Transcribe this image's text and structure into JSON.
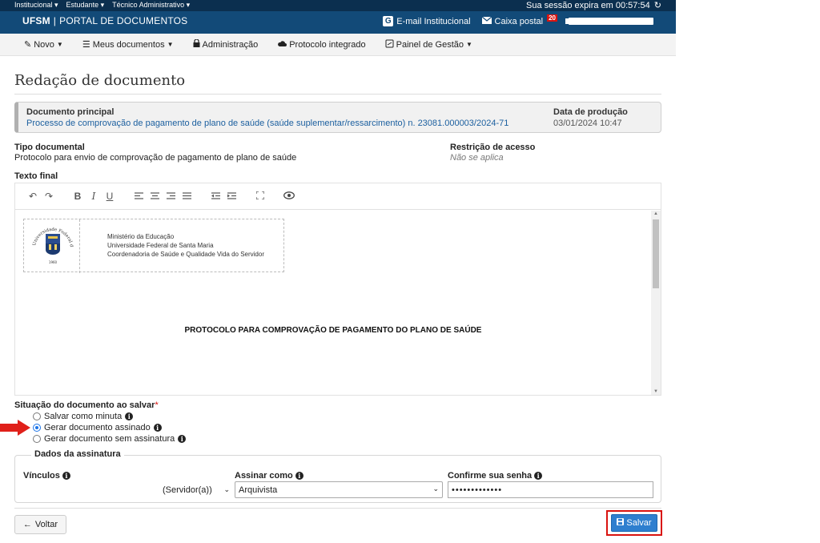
{
  "topbar": {
    "menus": [
      "Institucional ▾",
      "Estudante ▾",
      "Técnico Administrativo ▾"
    ],
    "session_text": "Sua sessão expira em 00:57:54"
  },
  "header": {
    "brand_bold": "UFSM",
    "brand_sep": "|",
    "brand_name": "PORTAL DE DOCUMENTOS",
    "email_icon_letter": "G",
    "email_label": "E-mail Institucional",
    "inbox_label": "Caixa postal",
    "inbox_count": "20"
  },
  "nav": {
    "items": [
      "Novo",
      "Meus documentos",
      "Administração",
      "Protocolo integrado",
      "Painel de Gestão"
    ]
  },
  "page": {
    "title": "Redação de documento"
  },
  "document": {
    "main_label": "Documento principal",
    "main_value": "Processo de comprovação de pagamento de plano de saúde (saúde suplementar/ressarcimento) n. 23081.000003/2024-71",
    "date_label": "Data de produção",
    "date_value": "03/01/2024 10:47",
    "type_label": "Tipo documental",
    "type_value": "Protocolo para envio de comprovação de pagamento de plano de saúde",
    "restriction_label": "Restrição de acesso",
    "restriction_value": "Não se aplica",
    "text_label": "Texto final"
  },
  "editor": {
    "letterhead": [
      "Ministério da Educação",
      "Universidade Federal de Santa Maria",
      "Coordenadoria de Saúde e Qualidade Vida do Servidor"
    ],
    "logo_text": "Universidade Federal de Santa Maria",
    "logo_year": "1960",
    "heading": "PROTOCOLO PARA COMPROVAÇÃO DE PAGAMENTO DO PLANO DE SAÚDE",
    "toolbar": {
      "bold": "B",
      "italic": "I",
      "underline": "U"
    }
  },
  "situation": {
    "label": "Situação do documento ao salvar",
    "required_mark": "*",
    "options": [
      "Salvar como minuta",
      "Gerar documento assinado",
      "Gerar documento sem assinatura"
    ],
    "selected_index": 1
  },
  "signature": {
    "legend": "Dados da assinatura",
    "links_label": "Vínculos",
    "links_value": "(Servidor(a))",
    "sign_as_label": "Assinar como",
    "sign_as_value": "Arquivista",
    "password_label": "Confirme sua senha",
    "password_value": "•••••••••••••"
  },
  "footer": {
    "back_label": "Voltar",
    "save_label": "Salvar"
  },
  "colors": {
    "header_bg": "#124a78",
    "topbar_bg": "#0b2f4f",
    "save_button": "#2e7fcf",
    "highlight_red": "#d9130f",
    "link_blue": "#1b5f9f"
  }
}
